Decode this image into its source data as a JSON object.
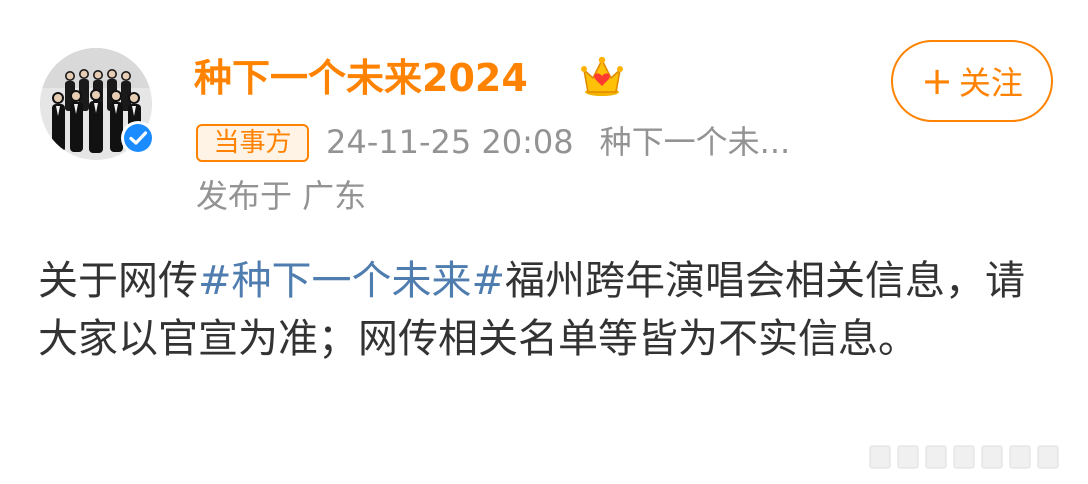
{
  "post": {
    "username": "种下一个未来2024",
    "follow_button": {
      "plus": "+",
      "label": "关注"
    },
    "party_badge": "当事方",
    "timestamp": "24-11-25 20:08",
    "source": "种下一个未...",
    "location": "发布于 广东",
    "body": {
      "prefix": "关于网传",
      "hashtag": "#种下一个未来#",
      "suffix": "福州跨年演唱会相关信息，请大家以官宣为准；网传相关名单等皆为不实信息。"
    }
  },
  "colors": {
    "brand_orange": "#ff8200",
    "meta_gray": "#939393",
    "hashtag_blue": "#507daf",
    "verified_blue": "#1a8cff",
    "text": "#333333"
  },
  "icons": {
    "avatar": "group-photo-avatar",
    "verified": "verified-badge-icon",
    "crown": "vip-crown-icon",
    "watermark": "repost-watermark"
  }
}
